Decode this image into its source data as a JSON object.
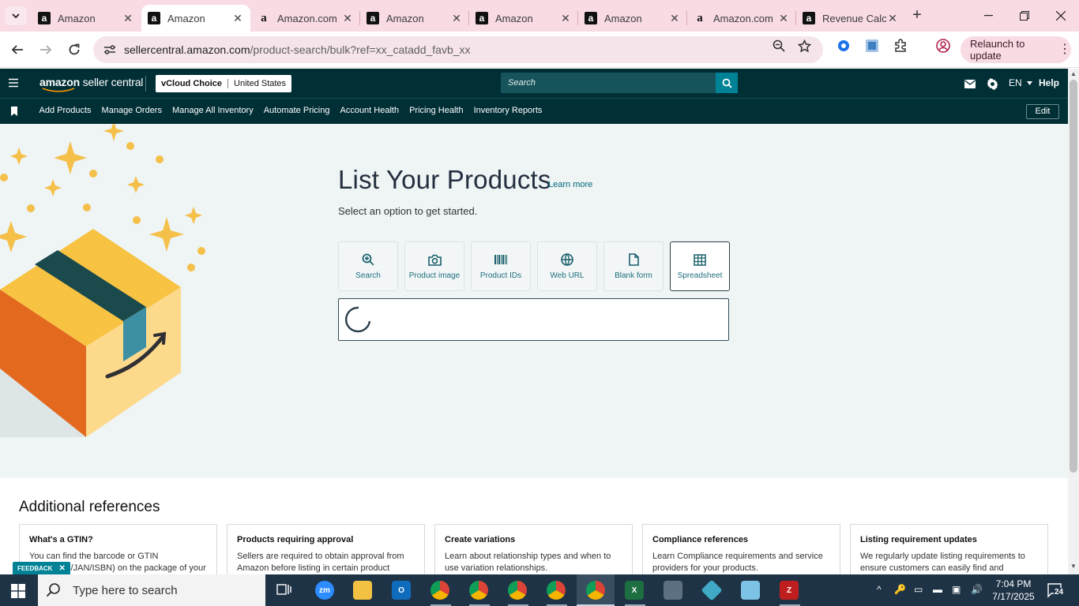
{
  "browser": {
    "tabs": [
      {
        "title": "Amazon",
        "favicon": "amazon-a-icon",
        "active": false
      },
      {
        "title": "Amazon",
        "favicon": "amazon-a-icon",
        "active": true
      },
      {
        "title": "Amazon.com",
        "favicon": "amazon-smile-icon",
        "active": false
      },
      {
        "title": "Amazon",
        "favicon": "amazon-a-icon",
        "active": false
      },
      {
        "title": "Amazon",
        "favicon": "amazon-a-icon",
        "active": false
      },
      {
        "title": "Amazon",
        "favicon": "amazon-a-icon",
        "active": false
      },
      {
        "title": "Amazon.com",
        "favicon": "amazon-smile-icon",
        "active": false
      },
      {
        "title": "Revenue Calculator",
        "favicon": "amazon-a-icon",
        "active": false
      }
    ],
    "url_host": "sellercentral.amazon.com",
    "url_path": "/product-search/bulk?ref=xx_catadd_favb_xx",
    "relaunch_label": "Relaunch to update",
    "accent_color": "#f9dbe4"
  },
  "seller_central": {
    "logo_prefix": "amazon",
    "logo_suffix": " seller central",
    "store_name": "vCloud Choice",
    "marketplace": "United States",
    "search_placeholder": "Search",
    "language": "EN",
    "help_label": "Help",
    "nav_links": [
      "Add Products",
      "Manage Orders",
      "Manage All Inventory",
      "Automate Pricing",
      "Account Health",
      "Pricing Health",
      "Inventory Reports"
    ],
    "edit_label": "Edit",
    "header_color": "#002f36"
  },
  "hero": {
    "title": "List Your Products",
    "learn_more": "Learn more",
    "subtitle": "Select an option to get started.",
    "options": [
      {
        "label": "Search",
        "icon": "search-plus-icon",
        "selected": false
      },
      {
        "label": "Product image",
        "icon": "camera-icon",
        "selected": false
      },
      {
        "label": "Product IDs",
        "icon": "barcode-icon",
        "selected": false
      },
      {
        "label": "Web URL",
        "icon": "globe-icon",
        "selected": false
      },
      {
        "label": "Blank form",
        "icon": "document-icon",
        "selected": false
      },
      {
        "label": "Spreadsheet",
        "icon": "spreadsheet-icon",
        "selected": true
      }
    ]
  },
  "references": {
    "title": "Additional references",
    "cards": [
      {
        "title": "What's a GTIN?",
        "desc": "You can find the barcode or GTIN (UPC/EAN/JAN/ISBN) on the package of your"
      },
      {
        "title": "Products requiring approval",
        "desc": "Sellers are required to obtain approval from Amazon before listing in certain product"
      },
      {
        "title": "Create variations",
        "desc": "Learn about relationship types and when to use variation relationships."
      },
      {
        "title": "Compliance references",
        "desc": "Learn Compliance requirements and service providers for your products."
      },
      {
        "title": "Listing requirement updates",
        "desc": "We regularly update listing requirements to ensure customers can easily find and evaluate"
      }
    ],
    "feedback_label": "FEEDBACK"
  },
  "taskbar": {
    "search_placeholder": "Type here to search",
    "time": "7:04 PM",
    "date": "7/17/2025",
    "notification_count": "24"
  }
}
